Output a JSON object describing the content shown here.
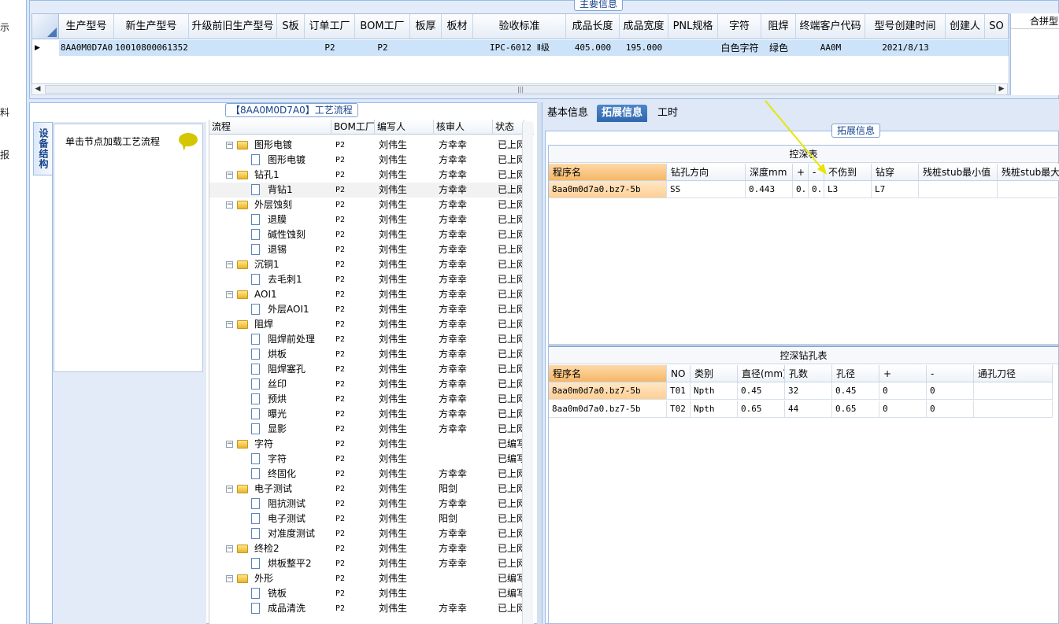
{
  "sidebar_fragments": [
    "示",
    "料",
    "报"
  ],
  "main_grid": {
    "caption": "主要信息",
    "columns": [
      "生产型号",
      "新生产型号",
      "升级前旧生产型号",
      "S板",
      "订单工厂",
      "BOM工厂",
      "板厚",
      "板材",
      "验收标准",
      "成品长度",
      "成品宽度",
      "PNL规格",
      "字符",
      "阻焊",
      "终端客户代码",
      "型号创建时间",
      "创建人",
      "SO"
    ],
    "row": [
      "8AA0M0D7A0",
      "10010800061352",
      "",
      "",
      "P2",
      "P2",
      "",
      "",
      "IPC-6012 Ⅱ级",
      "405.000",
      "195.000",
      "",
      "白色字符",
      "绿色",
      "AA0M",
      "2021/8/13",
      "",
      ""
    ],
    "row_indicator": "▶",
    "merge_header": "合拼型"
  },
  "process_panel": {
    "caption": "【8AA0M0D7A0】工艺流程",
    "vertical_tab": "设备结构",
    "node_hint": "单击节点加载工艺流程",
    "columns": [
      "流程",
      "BOM工厂",
      "编写人",
      "核审人",
      "状态"
    ],
    "rows": [
      {
        "name": "图形电镀",
        "type": "folder",
        "factory": "P2",
        "writer": "刘伟生",
        "reviewer": "方幸幸",
        "status": "已上网"
      },
      {
        "name": "图形电镀",
        "type": "doc",
        "factory": "P2",
        "writer": "刘伟生",
        "reviewer": "方幸幸",
        "status": "已上网"
      },
      {
        "name": "钻孔1",
        "type": "folder",
        "factory": "P2",
        "writer": "刘伟生",
        "reviewer": "方幸幸",
        "status": "已上网"
      },
      {
        "name": "背钻1",
        "type": "doc",
        "factory": "P2",
        "writer": "刘伟生",
        "reviewer": "方幸幸",
        "status": "已上网",
        "selected": true
      },
      {
        "name": "外层蚀刻",
        "type": "folder",
        "factory": "P2",
        "writer": "刘伟生",
        "reviewer": "方幸幸",
        "status": "已上网"
      },
      {
        "name": "退膜",
        "type": "doc",
        "factory": "P2",
        "writer": "刘伟生",
        "reviewer": "方幸幸",
        "status": "已上网"
      },
      {
        "name": "碱性蚀刻",
        "type": "doc",
        "factory": "P2",
        "writer": "刘伟生",
        "reviewer": "方幸幸",
        "status": "已上网"
      },
      {
        "name": "退锡",
        "type": "doc",
        "factory": "P2",
        "writer": "刘伟生",
        "reviewer": "方幸幸",
        "status": "已上网"
      },
      {
        "name": "沉铜1",
        "type": "folder",
        "factory": "P2",
        "writer": "刘伟生",
        "reviewer": "方幸幸",
        "status": "已上网"
      },
      {
        "name": "去毛刺1",
        "type": "doc",
        "factory": "P2",
        "writer": "刘伟生",
        "reviewer": "方幸幸",
        "status": "已上网"
      },
      {
        "name": "AOI1",
        "type": "folder",
        "factory": "P2",
        "writer": "刘伟生",
        "reviewer": "方幸幸",
        "status": "已上网"
      },
      {
        "name": "外层AOI1",
        "type": "doc",
        "factory": "P2",
        "writer": "刘伟生",
        "reviewer": "方幸幸",
        "status": "已上网"
      },
      {
        "name": "阻焊",
        "type": "folder",
        "factory": "P2",
        "writer": "刘伟生",
        "reviewer": "方幸幸",
        "status": "已上网"
      },
      {
        "name": "阻焊前处理",
        "type": "doc",
        "factory": "P2",
        "writer": "刘伟生",
        "reviewer": "方幸幸",
        "status": "已上网"
      },
      {
        "name": "烘板",
        "type": "doc",
        "factory": "P2",
        "writer": "刘伟生",
        "reviewer": "方幸幸",
        "status": "已上网"
      },
      {
        "name": "阻焊塞孔",
        "type": "doc",
        "factory": "P2",
        "writer": "刘伟生",
        "reviewer": "方幸幸",
        "status": "已上网"
      },
      {
        "name": "丝印",
        "type": "doc",
        "factory": "P2",
        "writer": "刘伟生",
        "reviewer": "方幸幸",
        "status": "已上网"
      },
      {
        "name": "预烘",
        "type": "doc",
        "factory": "P2",
        "writer": "刘伟生",
        "reviewer": "方幸幸",
        "status": "已上网"
      },
      {
        "name": "曝光",
        "type": "doc",
        "factory": "P2",
        "writer": "刘伟生",
        "reviewer": "方幸幸",
        "status": "已上网"
      },
      {
        "name": "显影",
        "type": "doc",
        "factory": "P2",
        "writer": "刘伟生",
        "reviewer": "方幸幸",
        "status": "已上网"
      },
      {
        "name": "字符",
        "type": "folder",
        "factory": "P2",
        "writer": "刘伟生",
        "reviewer": "",
        "status": "已编写"
      },
      {
        "name": "字符",
        "type": "doc",
        "factory": "P2",
        "writer": "刘伟生",
        "reviewer": "",
        "status": "已编写"
      },
      {
        "name": "终固化",
        "type": "doc",
        "factory": "P2",
        "writer": "刘伟生",
        "reviewer": "方幸幸",
        "status": "已上网"
      },
      {
        "name": "电子测试",
        "type": "folder",
        "factory": "P2",
        "writer": "刘伟生",
        "reviewer": "阳剑",
        "status": "已上网"
      },
      {
        "name": "阻抗测试",
        "type": "doc",
        "factory": "P2",
        "writer": "刘伟生",
        "reviewer": "方幸幸",
        "status": "已上网"
      },
      {
        "name": "电子测试",
        "type": "doc",
        "factory": "P2",
        "writer": "刘伟生",
        "reviewer": "阳剑",
        "status": "已上网"
      },
      {
        "name": "对准度测试",
        "type": "doc",
        "factory": "P2",
        "writer": "刘伟生",
        "reviewer": "方幸幸",
        "status": "已上网"
      },
      {
        "name": "终检2",
        "type": "folder",
        "factory": "P2",
        "writer": "刘伟生",
        "reviewer": "方幸幸",
        "status": "已上网"
      },
      {
        "name": "烘板整平2",
        "type": "doc",
        "factory": "P2",
        "writer": "刘伟生",
        "reviewer": "方幸幸",
        "status": "已上网"
      },
      {
        "name": "外形",
        "type": "folder",
        "factory": "P2",
        "writer": "刘伟生",
        "reviewer": "",
        "status": "已编写"
      },
      {
        "name": "铣板",
        "type": "doc",
        "factory": "P2",
        "writer": "刘伟生",
        "reviewer": "",
        "status": "已编写"
      },
      {
        "name": "成品清洗",
        "type": "doc",
        "factory": "P2",
        "writer": "刘伟生",
        "reviewer": "方幸幸",
        "status": "已上网"
      }
    ]
  },
  "right_panel": {
    "tabs": [
      "基本信息",
      "拓展信息",
      "工时"
    ],
    "ext_caption": "拓展信息",
    "depth_table": {
      "title": "控深表",
      "columns": [
        "程序名",
        "钻孔方向",
        "深度mm",
        "+",
        "-",
        "不伤到",
        "钻穿",
        "残桩stub最小值",
        "残桩stub最大"
      ],
      "rows": [
        [
          "8aa0m0d7a0.bz7-5b",
          "SS",
          "0.443",
          "0..",
          "0..",
          "L3",
          "L7",
          "",
          ""
        ]
      ]
    },
    "drill_table": {
      "title": "控深钻孔表",
      "columns": [
        "程序名",
        "NO",
        "类别",
        "直径(mm)",
        "孔数",
        "孔径",
        "+",
        "-",
        "通孔刀径"
      ],
      "rows": [
        [
          "8aa0m0d7a0.bz7-5b",
          "T01",
          "Npth",
          "0.45",
          "32",
          "0.45",
          "0",
          "0",
          ""
        ],
        [
          "8aa0m0d7a0.bz7-5b",
          "T02",
          "Npth",
          "0.65",
          "44",
          "0.65",
          "0",
          "0",
          ""
        ]
      ]
    }
  },
  "accent_colors": {
    "selection": "#cde3f9",
    "tab_active": "#2f67ad",
    "highlight_header": "#f5b766",
    "annotation_arrow": "#e6e600"
  }
}
